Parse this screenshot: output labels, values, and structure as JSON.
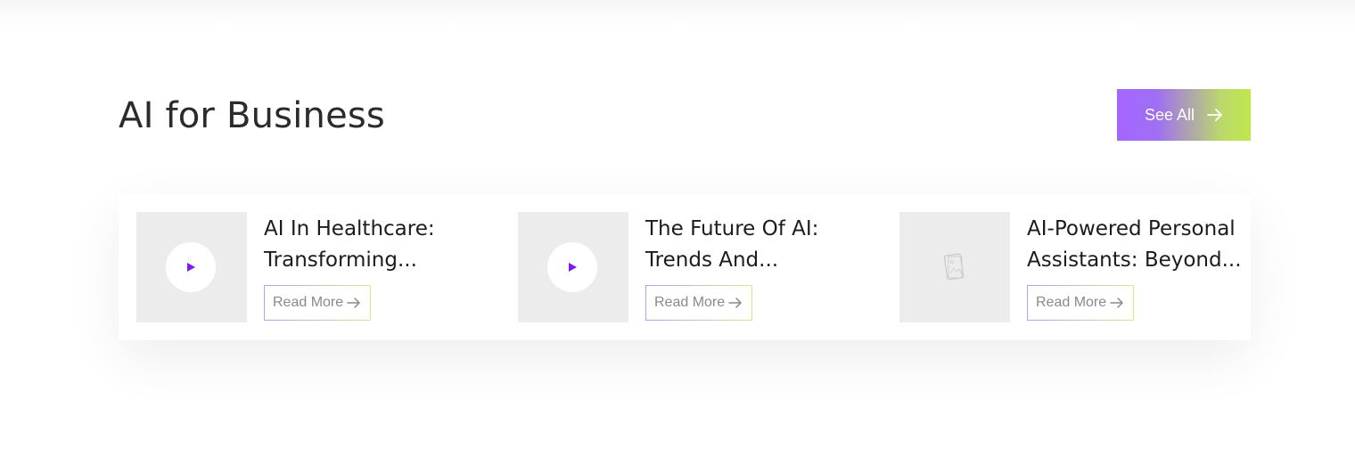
{
  "section": {
    "title": "AI for Business",
    "see_all_label": "See All"
  },
  "cards": [
    {
      "title_line1": "AI In Healthcare:",
      "title_line2": "Transforming...",
      "read_more_label": "Read More",
      "thumb_icon": "play-icon"
    },
    {
      "title_line1": "The Future Of AI:",
      "title_line2": "Trends And...",
      "read_more_label": "Read More",
      "thumb_icon": "play-icon"
    },
    {
      "title_line1": "AI-Powered Personal",
      "title_line2": "Assistants: Beyond...",
      "read_more_label": "Read More",
      "thumb_icon": "image-placeholder-icon"
    }
  ],
  "colors": {
    "accent_purple": "#7a1cf0",
    "gradient_start": "#a566ff",
    "gradient_end": "#bfe84a",
    "thumb_bg": "#ececec",
    "title_text": "#1c1c1c"
  }
}
